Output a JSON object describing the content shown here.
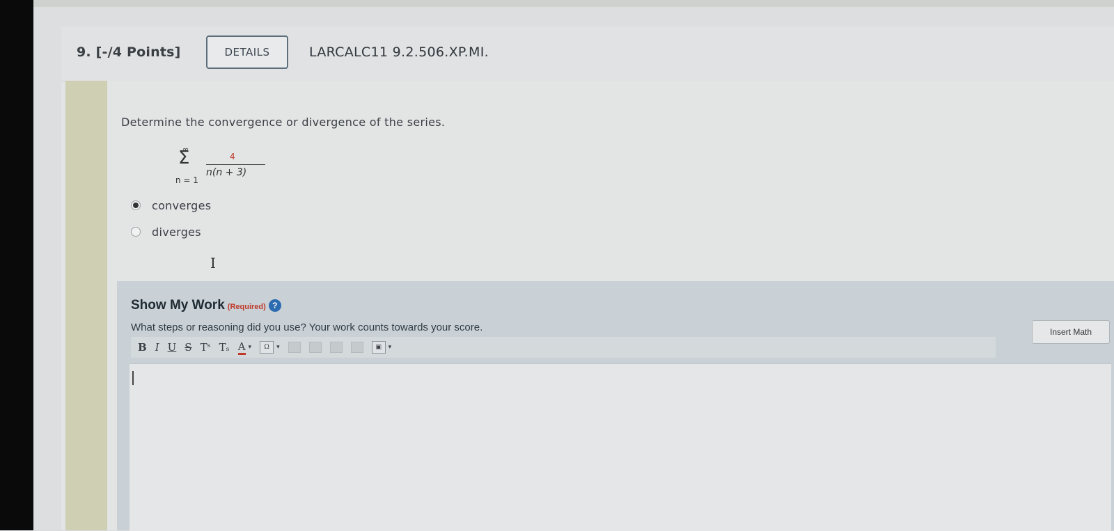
{
  "question": {
    "number_points": "9. [-/4 Points]",
    "details_label": "DETAILS",
    "reference": "LARCALC11 9.2.506.XP.MI.",
    "prompt": "Determine the convergence or divergence of the series.",
    "series": {
      "upper": "∞",
      "symbol": "Σ",
      "lower": "n = 1",
      "numerator": "4",
      "denominator": "n(n + 3)"
    },
    "choices": [
      {
        "label": "converges",
        "selected": true
      },
      {
        "label": "diverges",
        "selected": false
      }
    ],
    "cursor_glyph": "I"
  },
  "show_my_work": {
    "title": "Show My Work",
    "required": "(Required)",
    "help_glyph": "?",
    "description": "What steps or reasoning did you use? Your work counts towards your score.",
    "insert_math_label": "Insert Math",
    "toolbar": {
      "bold": "B",
      "italic": "I",
      "underline": "U",
      "strike": "S",
      "superscript": "Tˢ",
      "subscript": "Tₛ",
      "text_color": "A",
      "dropdown_caret": "▾"
    }
  },
  "colors": {
    "accent_red": "#c0392b",
    "help_blue": "#2b6cb0"
  }
}
